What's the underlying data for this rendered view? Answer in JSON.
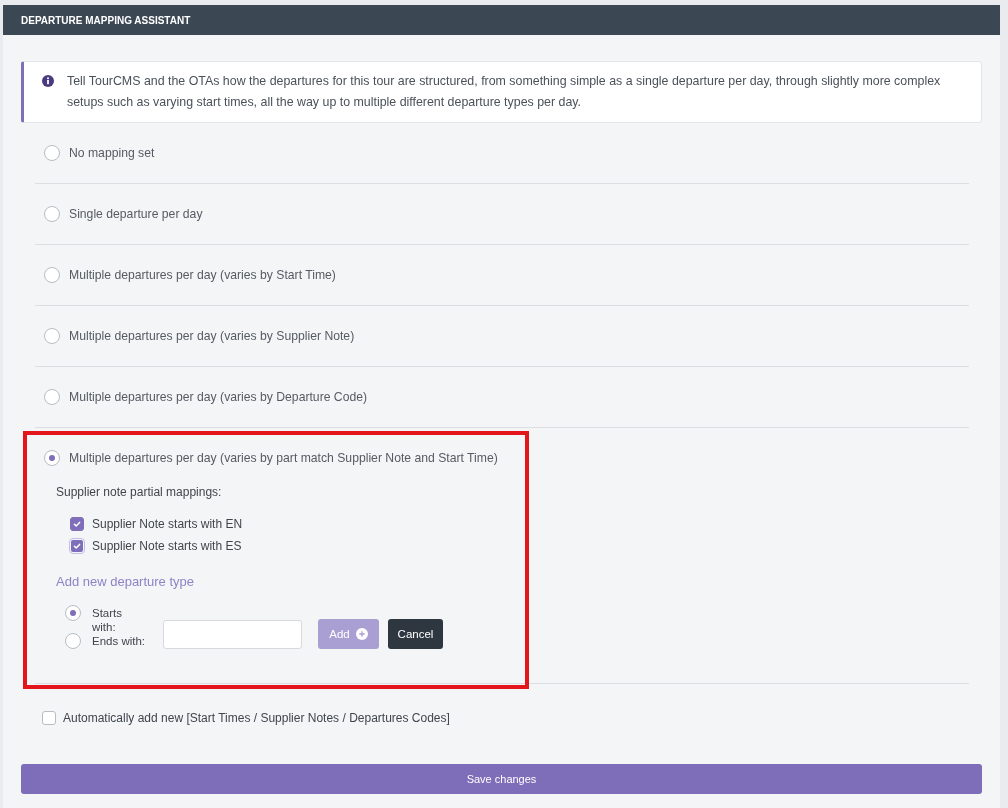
{
  "panel": {
    "title": "DEPARTURE MAPPING ASSISTANT"
  },
  "info": {
    "text": "Tell TourCMS and the OTAs how the departures for this tour are structured, from something simple as a single departure per day, through slightly more complex setups such as varying start times, all the way up to multiple different departure types per day."
  },
  "mapping_options": [
    {
      "label": "No mapping set",
      "selected": false,
      "highlighted": false
    },
    {
      "label": "Single departure per day",
      "selected": false,
      "highlighted": false
    },
    {
      "label": "Multiple departures per day (varies by Start Time)",
      "selected": false,
      "highlighted": false
    },
    {
      "label": "Multiple departures per day (varies by Supplier Note)",
      "selected": false,
      "highlighted": false
    },
    {
      "label": "Multiple departures per day (varies by Departure Code)",
      "selected": false,
      "highlighted": false
    },
    {
      "label": "Multiple departures per day (varies by part match Supplier Note and Start Time)",
      "selected": true,
      "highlighted": true,
      "details": {
        "mappings_heading": "Supplier note partial mappings:",
        "mappings": [
          {
            "label": "Supplier Note starts with EN",
            "checked": true,
            "focused": false
          },
          {
            "label": "Supplier Note starts with ES",
            "checked": true,
            "focused": true
          }
        ],
        "add_heading": "Add new departure type",
        "match_options": [
          {
            "label": "Starts with:",
            "selected": true
          },
          {
            "label": "Ends with:",
            "selected": false
          }
        ],
        "buttons": [
          {
            "kind": "add",
            "label": "Add",
            "disabled": true
          },
          {
            "kind": "cancel",
            "label": "Cancel",
            "disabled": false
          }
        ]
      }
    }
  ],
  "auto_add": {
    "label": "Automatically add new [Start Times / Supplier Notes / Departures Codes]",
    "checked": false
  },
  "save_button": {
    "label": "Save changes"
  }
}
